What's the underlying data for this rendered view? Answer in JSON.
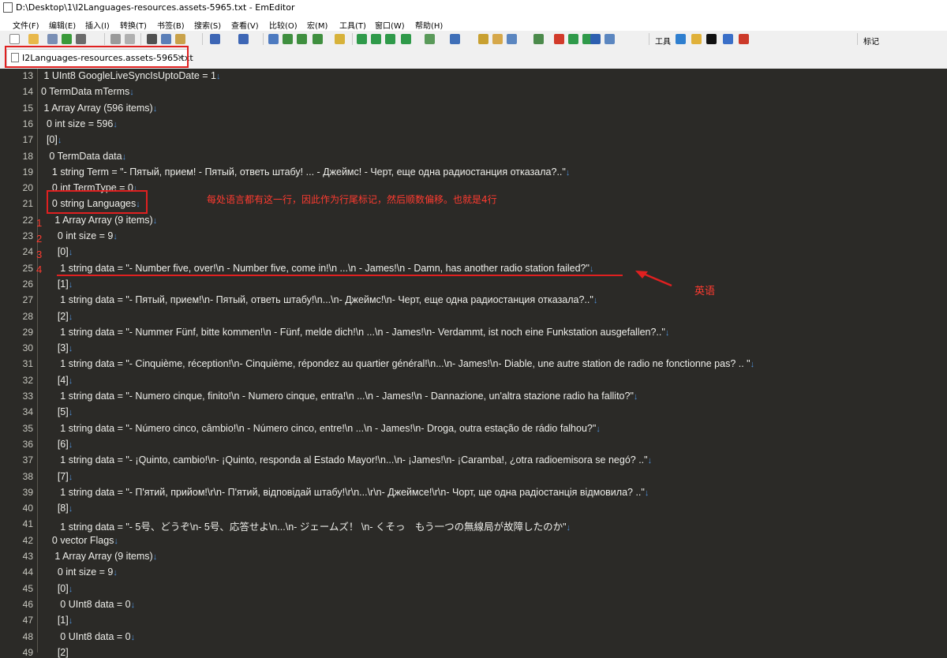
{
  "window": {
    "title": "D:\\Desktop\\1\\I2Languages-resources.assets-5965.txt - EmEditor"
  },
  "menu": [
    "文件(F)",
    "编辑(E)",
    "插入(I)",
    "转换(T)",
    "书签(B)",
    "搜索(S)",
    "查看(V)",
    "比较(O)",
    "宏(M)",
    "工具(T)",
    "窗口(W)",
    "帮助(H)"
  ],
  "toolbar": {
    "tools_label": "工具",
    "marker_label": "标记"
  },
  "tab": {
    "label": "I2Languages-resources.assets-5965.txt",
    "close": "×"
  },
  "lines": [
    {
      "n": "13",
      "text": " 1 UInt8 GoogleLiveSyncIsUptoDate = 1"
    },
    {
      "n": "14",
      "text": "0 TermData mTerms"
    },
    {
      "n": "15",
      "text": " 1 Array Array (596 items)"
    },
    {
      "n": "16",
      "text": "  0 int size = 596"
    },
    {
      "n": "17",
      "text": "  [0]"
    },
    {
      "n": "18",
      "text": "   0 TermData data"
    },
    {
      "n": "19",
      "text": "    1 string Term = \"- Пятый, прием! - Пятый, ответь штабу! ... - Джеймс! - Черт, еще одна радиостанция отказала?..\""
    },
    {
      "n": "20",
      "text": "    0 int TermType = 0"
    },
    {
      "n": "21",
      "text": "    0 string Languages"
    },
    {
      "n": "22",
      "text": "     1 Array Array (9 items)"
    },
    {
      "n": "23",
      "text": "      0 int size = 9"
    },
    {
      "n": "24",
      "text": "      [0]"
    },
    {
      "n": "25",
      "text": "       1 string data = \"- Number five, over!\\n - Number five, come in!\\n ...\\n - James!\\n - Damn, has another radio station failed?\""
    },
    {
      "n": "26",
      "text": "      [1]"
    },
    {
      "n": "27",
      "text": "       1 string data = \"- Пятый, прием!\\n- Пятый, ответь штабу!\\n...\\n- Джеймс!\\n- Черт, еще одна радиостанция отказала?..\""
    },
    {
      "n": "28",
      "text": "      [2]"
    },
    {
      "n": "29",
      "text": "       1 string data = \"- Nummer Fünf, bitte kommen!\\n - Fünf, melde dich!\\n ...\\n - James!\\n- Verdammt, ist noch eine Funkstation ausgefallen?..\""
    },
    {
      "n": "30",
      "text": "      [3]"
    },
    {
      "n": "31",
      "text": "       1 string data = \"- Cinquième, réception!\\n- Cinquième, répondez au quartier général!\\n...\\n- James!\\n- Diable, une autre station de radio ne fonctionne pas? .. \""
    },
    {
      "n": "32",
      "text": "      [4]"
    },
    {
      "n": "33",
      "text": "       1 string data = \"- Numero cinque, finito!\\n - Numero cinque, entra!\\n ...\\n - James!\\n - Dannazione, un'altra stazione radio ha fallito?\""
    },
    {
      "n": "34",
      "text": "      [5]"
    },
    {
      "n": "35",
      "text": "       1 string data = \"- Número cinco, câmbio!\\n - Número cinco, entre!\\n ...\\n - James!\\n- Droga, outra estação de rádio falhou?\""
    },
    {
      "n": "36",
      "text": "      [6]"
    },
    {
      "n": "37",
      "text": "       1 string data = \"- ¡Quinto, cambio!\\n- ¡Quinto, responda al Estado Mayor!\\n...\\n- ¡James!\\n- ¡Caramba!, ¿otra radioemisora se negó? ..\""
    },
    {
      "n": "38",
      "text": "      [7]"
    },
    {
      "n": "39",
      "text": "       1 string data = \"- П'ятий, прийом!\\r\\n- П'ятий, відповідай штабу!\\r\\n...\\r\\n- Джеймсе!\\r\\n- Чорт, ще одна радіостанція відмовила? ..\""
    },
    {
      "n": "40",
      "text": "      [8]"
    },
    {
      "n": "41",
      "text": "       1 string data = \"- 5号、どうぞ\\n- 5号、応答せよ\\n...\\n- ジェームズ！ \\n- くそっ　もう一つの無線局が故障したのか\""
    },
    {
      "n": "42",
      "text": "    0 vector Flags"
    },
    {
      "n": "43",
      "text": "     1 Array Array (9 items)"
    },
    {
      "n": "44",
      "text": "      0 int size = 9"
    },
    {
      "n": "45",
      "text": "      [0]"
    },
    {
      "n": "46",
      "text": "       0 UInt8 data = 0"
    },
    {
      "n": "47",
      "text": "      [1]"
    },
    {
      "n": "48",
      "text": "       0 UInt8 data = 0"
    },
    {
      "n": "49",
      "text": "      [2]"
    }
  ],
  "annotations": {
    "note": "每处语言都有这一行，因此作为行尾标记，然后顺数偏移。也就是4行",
    "steps": [
      "1",
      "2",
      "3",
      "4"
    ],
    "english_label": "英语"
  },
  "colors": {
    "editor_bg": "#2b2a27",
    "code_text": "#eeeeea",
    "eol_mark": "#4f8fd6",
    "annotation": "#e02020"
  }
}
